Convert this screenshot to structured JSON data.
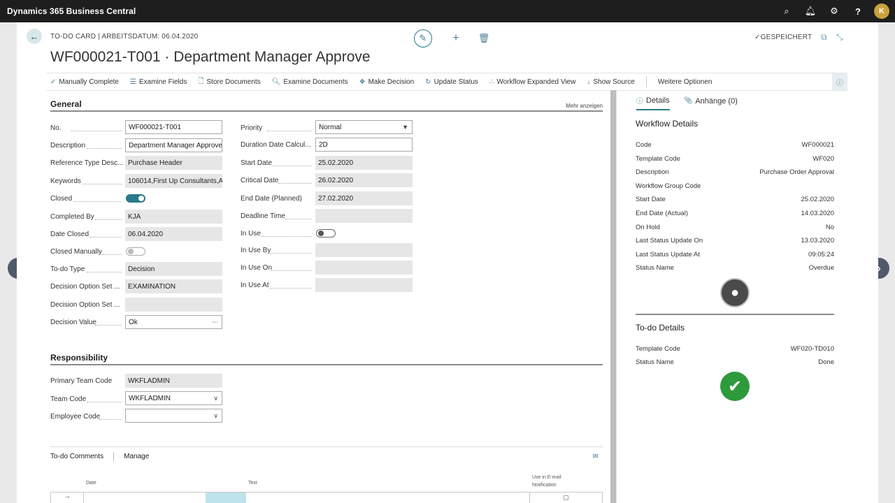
{
  "app": {
    "title": "Dynamics 365 Business Central",
    "avatar_initial": "K"
  },
  "topbar": {
    "icons": [
      "search-icon",
      "bell-icon",
      "gear-icon",
      "help-icon"
    ]
  },
  "card": {
    "breadcrumb": "TO-DO CARD | ARBEITSDATUM: 06.04.2020",
    "title": "WF000021-T001 · Department Manager Approve",
    "saved_label": "GESPEICHERT"
  },
  "actions": [
    {
      "label": "Manually Complete",
      "icon": "check-icon"
    },
    {
      "label": "Examine Fields",
      "icon": "fields-icon"
    },
    {
      "label": "Store Documents",
      "icon": "document-icon"
    },
    {
      "label": "Examine Documents",
      "icon": "examine-document-icon"
    },
    {
      "label": "Make Decision",
      "icon": "decision-icon"
    },
    {
      "label": "Update Status",
      "icon": "refresh-icon"
    },
    {
      "label": "Workflow Expanded View",
      "icon": "workflow-icon"
    },
    {
      "label": "Show Source",
      "icon": "arrow-down-icon"
    }
  ],
  "more_options": "Weitere Optionen",
  "general": {
    "title": "General",
    "more_link": "Mehr anzeigen",
    "left": {
      "no": {
        "label": "No.",
        "value": "WF000021-T001"
      },
      "description": {
        "label": "Description",
        "value": "Department Manager Approve"
      },
      "reference_type": {
        "label": "Reference Type Desc...",
        "value": "Purchase Header"
      },
      "keywords": {
        "label": "Keywords",
        "value": "106014,First Up Consultants,A..."
      },
      "closed": {
        "label": "Closed"
      },
      "completed_by": {
        "label": "Completed By",
        "value": "KJA"
      },
      "date_closed": {
        "label": "Date Closed",
        "value": "06.04.2020"
      },
      "closed_manually": {
        "label": "Closed Manually"
      },
      "todo_type": {
        "label": "To-do Type",
        "value": "Decision"
      },
      "decision_option_set1": {
        "label": "Decision Option Set ...",
        "value": "EXAMINATION"
      },
      "decision_option_set2": {
        "label": "Decision Option Set ...",
        "value": ""
      },
      "decision_value": {
        "label": "Decision Value",
        "value": "Ok"
      }
    },
    "right": {
      "priority": {
        "label": "Priority",
        "value": "Normal"
      },
      "duration": {
        "label": "Duration Date Calcul...",
        "value": "2D"
      },
      "start_date": {
        "label": "Start Date",
        "value": "25.02.2020"
      },
      "critical_date": {
        "label": "Critical Date",
        "value": "26.02.2020"
      },
      "end_date_planned": {
        "label": "End Date (Planned)",
        "value": "27.02.2020"
      },
      "deadline_time": {
        "label": "Deadline Time",
        "value": ""
      },
      "in_use": {
        "label": "In Use"
      },
      "in_use_by": {
        "label": "In Use By",
        "value": ""
      },
      "in_use_on": {
        "label": "In Use On",
        "value": ""
      },
      "in_use_at": {
        "label": "In Use At",
        "value": ""
      }
    }
  },
  "responsibility": {
    "title": "Responsibility",
    "primary_team": {
      "label": "Primary Team Code",
      "value": "WKFLADMIN"
    },
    "team": {
      "label": "Team Code",
      "value": "WKFLADMIN"
    },
    "employee": {
      "label": "Employee Code",
      "value": ""
    }
  },
  "comments": {
    "title": "To-do Comments",
    "manage": "Manage",
    "col_date": "Date",
    "col_text": "Text",
    "col_email_1": "Use in E-mail",
    "col_email_2": "Notification"
  },
  "factbox": {
    "tab_details": "Details",
    "tab_attachments": "Anhänge (0)",
    "workflow_title": "Workflow Details",
    "workflow_rows": [
      {
        "label": "Code",
        "value": "WF000021"
      },
      {
        "label": "Template Code",
        "value": "WF020"
      },
      {
        "label": "Description",
        "value": "Purchase Order Approval"
      },
      {
        "label": "Workflow Group Code",
        "value": ""
      },
      {
        "label": "Start Date",
        "value": "25.02.2020"
      },
      {
        "label": "End Date (Actual)",
        "value": "14.03.2020"
      },
      {
        "label": "On Hold",
        "value": "No"
      },
      {
        "label": "Last Status Update On",
        "value": "13.03.2020"
      },
      {
        "label": "Last Status Update At",
        "value": "09:05:24"
      },
      {
        "label": "Status Name",
        "value": "Overdue"
      }
    ],
    "todo_title": "To-do Details",
    "todo_rows": [
      {
        "label": "Template Code",
        "value": "WF020-TD010"
      },
      {
        "label": "Status Name",
        "value": "Done"
      }
    ]
  }
}
